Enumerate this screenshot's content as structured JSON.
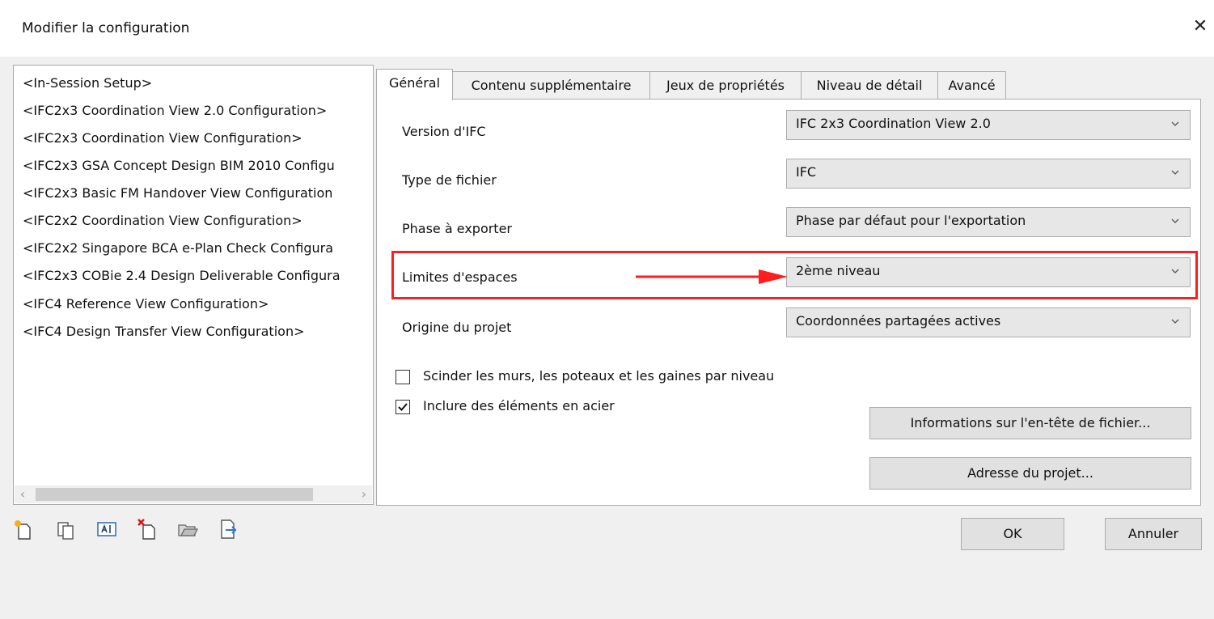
{
  "window": {
    "title": "Modifier la configuration",
    "close_glyph": "✕"
  },
  "configs": [
    "<In-Session Setup>",
    "<IFC2x3 Coordination View 2.0 Configuration>",
    "<IFC2x3 Coordination View Configuration>",
    "<IFC2x3 GSA Concept Design BIM 2010 Configu",
    "<IFC2x3 Basic FM Handover View Configuration",
    "<IFC2x2 Coordination View Configuration>",
    "<IFC2x2 Singapore BCA e-Plan Check Configura",
    "<IFC2x3 COBie 2.4 Design Deliverable Configura",
    "<IFC4 Reference View Configuration>",
    "<IFC4 Design Transfer View Configuration>"
  ],
  "scrollbar": {
    "left_glyph": "‹",
    "right_glyph": "›"
  },
  "toolbar_icons": [
    "new-setup-icon",
    "duplicate-setup-icon",
    "rename-setup-icon",
    "delete-setup-icon",
    "import-setup-icon",
    "export-setup-icon"
  ],
  "tabs": [
    {
      "label": "Général",
      "active": true
    },
    {
      "label": "Contenu supplémentaire",
      "active": false
    },
    {
      "label": "Jeux de propriétés",
      "active": false
    },
    {
      "label": "Niveau de détail",
      "active": false
    },
    {
      "label": "Avancé",
      "active": false
    }
  ],
  "fields": [
    {
      "label": "Version d'IFC",
      "value": "IFC 2x3 Coordination View 2.0"
    },
    {
      "label": "Type de fichier",
      "value": "IFC"
    },
    {
      "label": "Phase à exporter",
      "value": "Phase par défaut pour l'exportation"
    },
    {
      "label": "Limites d'espaces",
      "value": "2ème niveau"
    },
    {
      "label": "Origine du projet",
      "value": "Coordonnées partagées actives"
    }
  ],
  "checkboxes": [
    {
      "label": "Scinder les murs, les poteaux et les gaines par niveau",
      "checked": false
    },
    {
      "label": "Inclure des éléments en acier",
      "checked": true
    }
  ],
  "buttons": {
    "file_header": "Informations sur l'en-tête de fichier...",
    "project_address": "Adresse du projet...",
    "ok": "OK",
    "cancel": "Annuler"
  },
  "colors": {
    "highlight": "#ff1d1d",
    "window_bg": "#f0f0f0",
    "panel_bg": "#ffffff"
  }
}
